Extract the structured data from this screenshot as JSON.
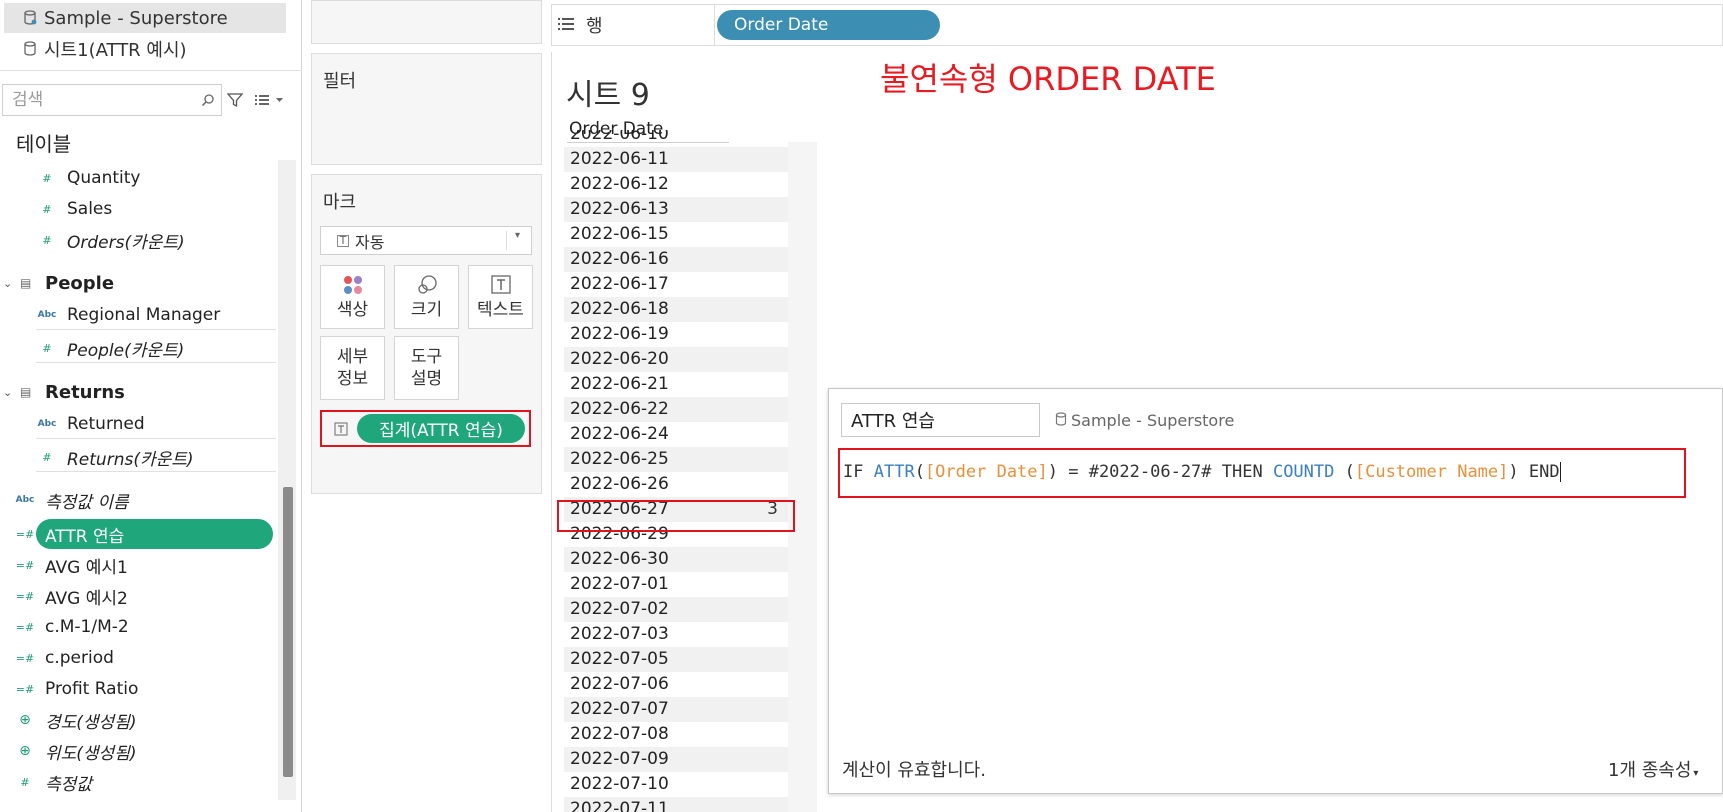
{
  "datasources": [
    {
      "label": "Sample - Superstore",
      "icon": "datasource-icon",
      "selected": true
    },
    {
      "label": "시트1(ATTR   예시)",
      "icon": "cylinder-icon",
      "selected": false
    }
  ],
  "search": {
    "placeholder": "검색"
  },
  "tables_heading": "테이블",
  "fields": {
    "quantity": "Quantity",
    "sales": "Sales",
    "orders_count": "Orders(카운트)",
    "people_group": "People",
    "regional_manager": "Regional Manager",
    "people_count": "People(카운트)",
    "returns_group": "Returns",
    "returned": "Returned",
    "returns_count": "Returns(카운트)",
    "measure_names": "측정값 이름",
    "attr_practice": "ATTR 연습",
    "avg1": "AVG 예시1",
    "avg2": "AVG 예시2",
    "cm": "c.M-1/M-2",
    "cperiod": "c.period",
    "profit_ratio": "Profit Ratio",
    "longitude": "경도(생성됨)",
    "latitude": "위도(생성됨)",
    "measure_values": "측정값"
  },
  "icons": {
    "abc": "Abc",
    "hash": "#",
    "calc_hash": "=#",
    "globe": "⊕"
  },
  "filters_title": "필터",
  "marks": {
    "title": "마크",
    "type": "자동",
    "color": "색상",
    "size": "크기",
    "text": "텍스트",
    "detail_line1": "세부",
    "detail_line2": "정보",
    "tooltip_line1": "도구",
    "tooltip_line2": "설명",
    "agg_pill": "집계(ATTR 연습)"
  },
  "rows": {
    "label": "행",
    "pill": "Order Date"
  },
  "sheet": {
    "title": "시트 9",
    "annotation": "불연속형 ORDER DATE",
    "column_header": "Order Date"
  },
  "date_rows": [
    {
      "date": "2022-06-10",
      "value": ""
    },
    {
      "date": "2022-06-11",
      "value": ""
    },
    {
      "date": "2022-06-12",
      "value": ""
    },
    {
      "date": "2022-06-13",
      "value": ""
    },
    {
      "date": "2022-06-15",
      "value": ""
    },
    {
      "date": "2022-06-16",
      "value": ""
    },
    {
      "date": "2022-06-17",
      "value": ""
    },
    {
      "date": "2022-06-18",
      "value": ""
    },
    {
      "date": "2022-06-19",
      "value": ""
    },
    {
      "date": "2022-06-20",
      "value": ""
    },
    {
      "date": "2022-06-21",
      "value": ""
    },
    {
      "date": "2022-06-22",
      "value": ""
    },
    {
      "date": "2022-06-24",
      "value": ""
    },
    {
      "date": "2022-06-25",
      "value": ""
    },
    {
      "date": "2022-06-26",
      "value": ""
    },
    {
      "date": "2022-06-27",
      "value": "3"
    },
    {
      "date": "2022-06-29",
      "value": ""
    },
    {
      "date": "2022-06-30",
      "value": ""
    },
    {
      "date": "2022-07-01",
      "value": ""
    },
    {
      "date": "2022-07-02",
      "value": ""
    },
    {
      "date": "2022-07-03",
      "value": ""
    },
    {
      "date": "2022-07-05",
      "value": ""
    },
    {
      "date": "2022-07-06",
      "value": ""
    },
    {
      "date": "2022-07-07",
      "value": ""
    },
    {
      "date": "2022-07-08",
      "value": ""
    },
    {
      "date": "2022-07-09",
      "value": ""
    },
    {
      "date": "2022-07-10",
      "value": ""
    },
    {
      "date": "2022-07-11",
      "value": ""
    }
  ],
  "calc": {
    "name": "ATTR 연습",
    "source": "Sample - Superstore",
    "formula": {
      "if": "IF",
      "attr": "ATTR",
      "paren_open": "(",
      "field1": "[Order Date]",
      "eq": ") = #2022-06-27# THEN",
      "countd": "COUNTD",
      "paren_open2": " (",
      "field2": "[Customer Name]",
      "end": ") END"
    },
    "status": "계산이 유효합니다.",
    "dependencies": "1개 종속성"
  },
  "colors": {
    "green_pill": "#1fa67a",
    "blue_pill": "#3c8fb3",
    "highlight_red": "#e0141e",
    "annotation_red": "#e81b23"
  }
}
